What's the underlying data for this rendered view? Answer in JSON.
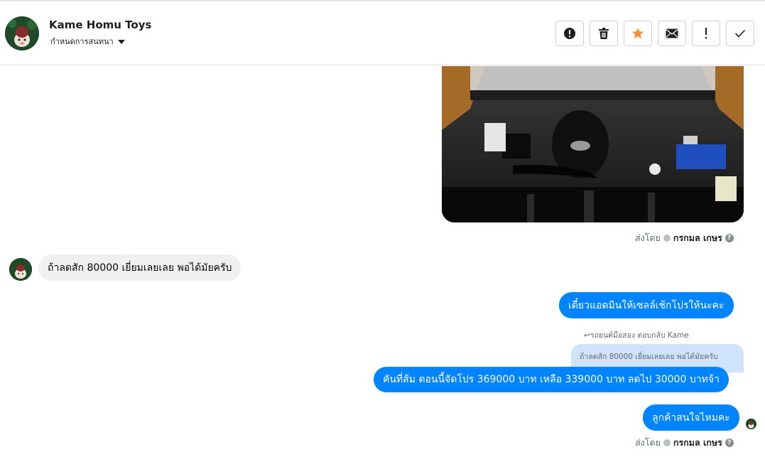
{
  "header": {
    "page_name": "Kame Homu Toys",
    "assign_label": "กำหนดการสนทนา",
    "actions": [
      {
        "icon": "alert-circle-icon"
      },
      {
        "icon": "trash-icon"
      },
      {
        "icon": "star-icon",
        "color": "#f7923b"
      },
      {
        "icon": "envelope-icon"
      },
      {
        "icon": "exclamation-icon"
      },
      {
        "icon": "check-icon"
      }
    ]
  },
  "messages": {
    "sent_by_prefix": "ส่งโดย",
    "sent_by_name": "กรกมล เกษร",
    "incoming_1": "ถ้าลดสัก 80000 เยี่ยมเลยเลย  พอได้มัยครับ",
    "outgoing_1": "เดี๋ยวแอดมินให้เซลล์เช้กโปรให้นะคะ",
    "reply_label": "รถยนต์มือสอง ตอบกลับ Kame",
    "quoted_text": "ถ้าลดสัก 80000 เยี่ยมเลยเลย พอได้มัยครับ",
    "outgoing_2": "คันที่ส้ม ตอนนี้จัดโปร 369000 บาท เหลือ 339000 บาท ลดไป 30000 บาทจ้า",
    "outgoing_3": "ลูกค้าสนใจไหมคะ"
  },
  "colors": {
    "accent": "#0084ff",
    "incoming_bg": "#f0f0f0",
    "quoted_bg": "#cfe4fc"
  }
}
